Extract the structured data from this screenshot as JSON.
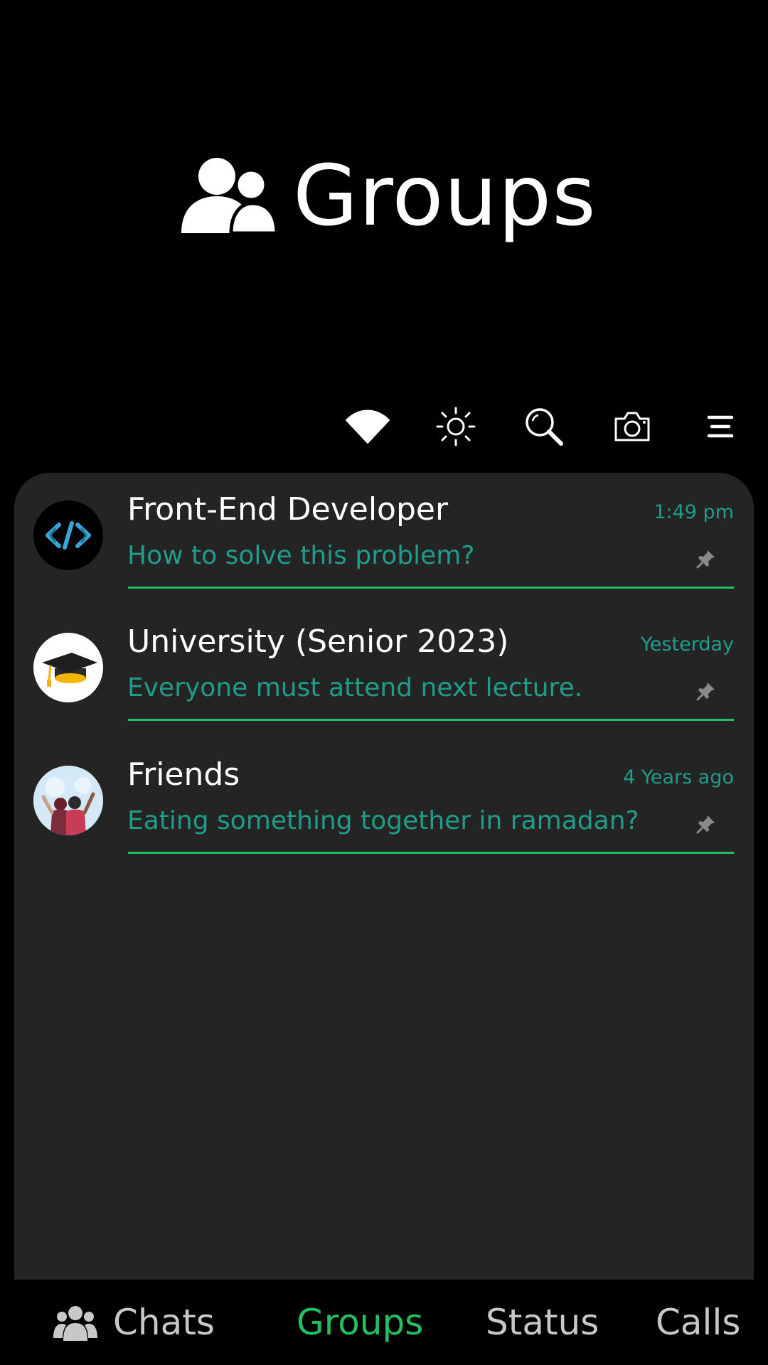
{
  "header": {
    "title": "Groups",
    "title_icon": "people-group-icon"
  },
  "toolbar": {
    "icons": [
      "wifi-icon",
      "brightness-icon",
      "search-icon",
      "camera-icon",
      "menu-icon"
    ]
  },
  "groups": [
    {
      "name": "Front-End Developer",
      "time": "1:49 pm",
      "message": "How to solve this problem?",
      "avatar": "code-logo-avatar",
      "pinned": true
    },
    {
      "name": "University (Senior 2023)",
      "time": "Yesterday",
      "message": "Everyone must attend next lecture.",
      "avatar": "graduation-cap-avatar",
      "pinned": true
    },
    {
      "name": "Friends",
      "time": "4 Years ago",
      "message": "Eating something together in ramadan?",
      "avatar": "friends-illustration-avatar",
      "pinned": true
    }
  ],
  "bottom_nav": {
    "items": [
      {
        "label": "Chats",
        "icon": "people-group-icon"
      },
      {
        "label": "Groups"
      },
      {
        "label": "Status"
      },
      {
        "label": "Calls"
      }
    ],
    "active": "Groups"
  },
  "colors": {
    "background": "#000000",
    "card": "#242424",
    "accent_green": "#21c063",
    "teal_text": "#1f9c8a",
    "nav_inactive": "#c8c8c8"
  }
}
